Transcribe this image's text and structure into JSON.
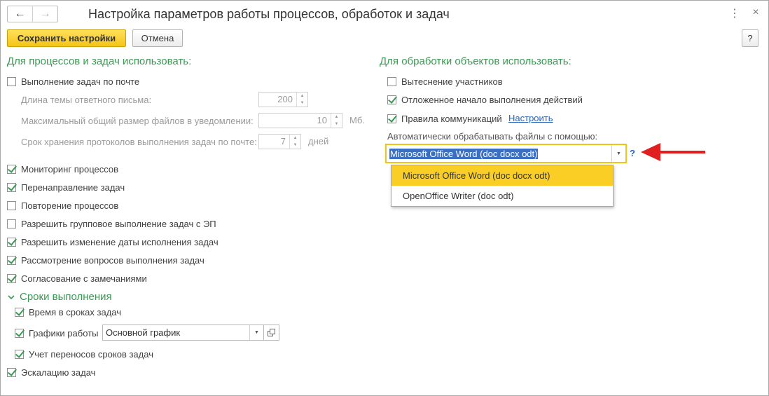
{
  "window": {
    "title": "Настройка параметров работы процессов, обработок и задач",
    "nav_back": "←",
    "nav_forward": "→",
    "menu_icon": "⋮",
    "close_icon": "×"
  },
  "toolbar": {
    "save_label": "Сохранить настройки",
    "cancel_label": "Отмена",
    "help_label": "?"
  },
  "left": {
    "header": "Для процессов и задач использовать:",
    "mail_tasks": {
      "label": "Выполнение задач по почте",
      "checked": false
    },
    "reply_subject_length": {
      "label": "Длина темы ответного письма:",
      "value": "200"
    },
    "max_file_size": {
      "label": "Максимальный общий размер файлов в уведомлении:",
      "value": "10",
      "unit": "Мб."
    },
    "log_retention": {
      "label": "Срок хранения протоколов выполнения задач по почте:",
      "value": "7",
      "unit": "дней"
    },
    "options": [
      {
        "label": "Мониторинг процессов",
        "checked": true
      },
      {
        "label": "Перенаправление задач",
        "checked": true
      },
      {
        "label": "Повторение процессов",
        "checked": false
      },
      {
        "label": "Разрешить групповое выполнение задач с ЭП",
        "checked": false
      },
      {
        "label": "Разрешить изменение даты исполнения задач",
        "checked": true
      },
      {
        "label": "Рассмотрение вопросов выполнения задач",
        "checked": true
      },
      {
        "label": "Согласование с замечаниями",
        "checked": true
      }
    ],
    "deadlines": {
      "header": "Сроки выполнения",
      "time_in_deadlines": {
        "label": "Время в сроках задач",
        "checked": true
      },
      "work_schedules": {
        "label": "Графики работы",
        "checked": true,
        "value": "Основной график"
      },
      "deadline_transfers": {
        "label": "Учет переносов сроков задач",
        "checked": true
      }
    },
    "escalation": {
      "label": "Эскалацию задач",
      "checked": true
    }
  },
  "right": {
    "header": "Для обработки объектов использовать:",
    "options": [
      {
        "label": "Вытеснение участников",
        "checked": false
      },
      {
        "label": "Отложенное начало выполнения действий",
        "checked": true
      },
      {
        "label": "Правила коммуникаций",
        "checked": true
      }
    ],
    "configure_link": "Настроить",
    "auto_process_label": "Автоматически обрабатывать файлы с помощью:",
    "auto_process_value": "Microsoft Office Word (doc docx odt)",
    "help_mark": "?",
    "dropdown_options": [
      "Microsoft Office Word (doc docx odt)",
      "OpenOffice Writer (doc odt)"
    ]
  },
  "colors": {
    "accent_green": "#3a9a53",
    "highlight_yellow": "#fbce25",
    "arrow_red": "#e02020",
    "link_blue": "#2a64b5"
  }
}
